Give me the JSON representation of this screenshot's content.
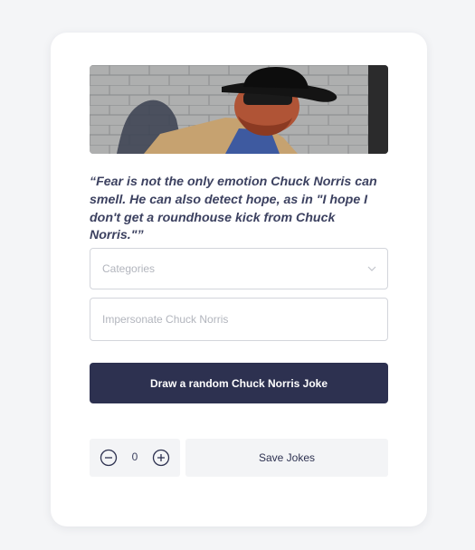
{
  "joke": {
    "text": "“Fear is not the only emotion Chuck Norris can smell. He can also detect hope, as in \"I hope I don't get a roundhouse kick from Chuck Norris.\"”"
  },
  "hero_image": {
    "icon": "chuck-norris-photo"
  },
  "category_select": {
    "placeholder": "Categories",
    "icon": "chevron-down-icon"
  },
  "impersonate_input": {
    "placeholder": "Impersonate Chuck Norris",
    "value": ""
  },
  "draw_button": {
    "label": "Draw a random Chuck Norris Joke"
  },
  "stepper": {
    "value": "0",
    "minus_icon": "minus-circle-icon",
    "plus_icon": "plus-circle-icon"
  },
  "save_button": {
    "label": "Save Jokes"
  },
  "colors": {
    "background": "#f4f5f7",
    "card": "#ffffff",
    "primary": "#2d3150",
    "text": "#3c4160",
    "muted": "#b2b5bd",
    "secondary_button": "#f3f4f6"
  }
}
